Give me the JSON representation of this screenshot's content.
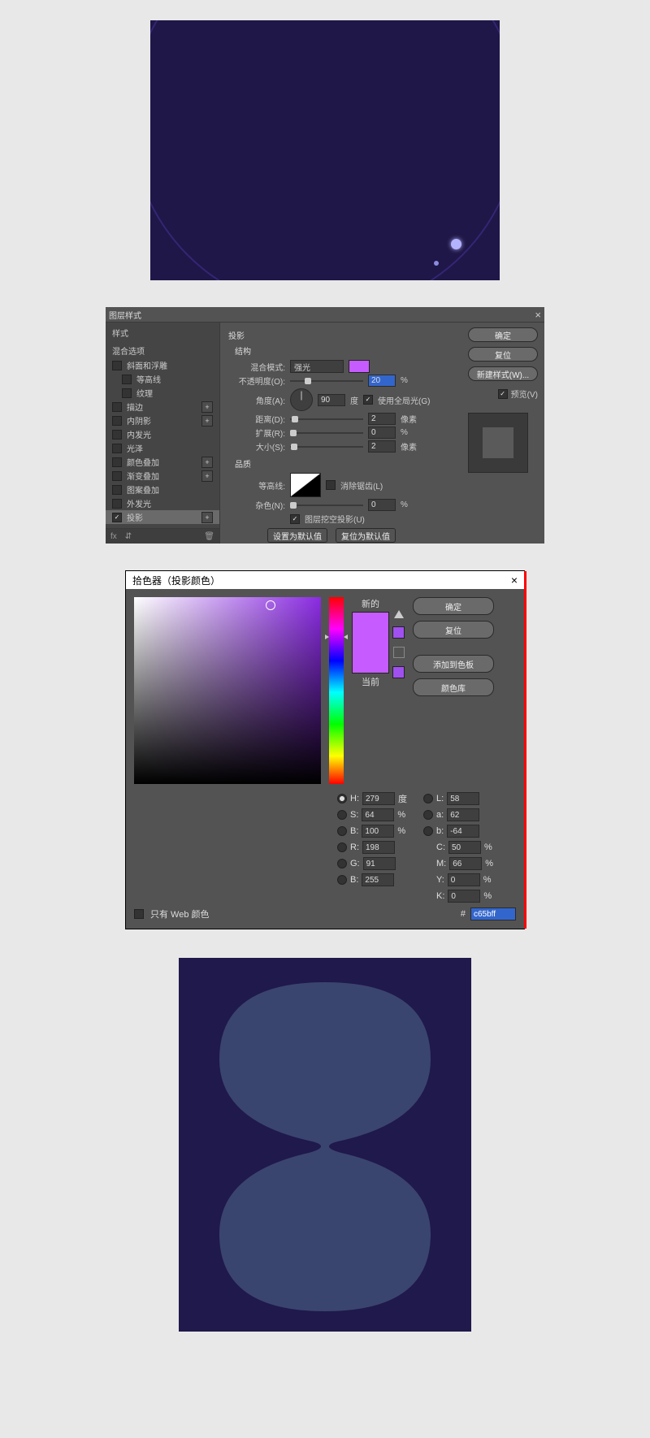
{
  "layer_style_dialog": {
    "title": "图层样式",
    "left": {
      "styles_header": "样式",
      "blend_options": "混合选项",
      "items": [
        {
          "label": "斜面和浮雕",
          "checked": false,
          "plus": false
        },
        {
          "label": "等高线",
          "checked": false,
          "plus": false,
          "indent": true
        },
        {
          "label": "纹理",
          "checked": false,
          "plus": false,
          "indent": true
        },
        {
          "label": "描边",
          "checked": false,
          "plus": true
        },
        {
          "label": "内阴影",
          "checked": false,
          "plus": true
        },
        {
          "label": "内发光",
          "checked": false,
          "plus": false
        },
        {
          "label": "光泽",
          "checked": false,
          "plus": false
        },
        {
          "label": "颜色叠加",
          "checked": false,
          "plus": true
        },
        {
          "label": "渐变叠加",
          "checked": false,
          "plus": true
        },
        {
          "label": "图案叠加",
          "checked": false,
          "plus": false
        },
        {
          "label": "外发光",
          "checked": false,
          "plus": false
        },
        {
          "label": "投影",
          "checked": true,
          "plus": true,
          "selected": true
        }
      ],
      "footer_fx": "fx"
    },
    "mid": {
      "section": "投影",
      "structure": "结构",
      "blend_mode_label": "混合模式:",
      "blend_mode_value": "强光",
      "opacity_label": "不透明度(O):",
      "opacity_value": "20",
      "opacity_unit": "%",
      "angle_label": "角度(A):",
      "angle_value": "90",
      "angle_unit": "度",
      "global_light": "使用全局光(G)",
      "distance_label": "距离(D):",
      "distance_value": "2",
      "distance_unit": "像素",
      "spread_label": "扩展(R):",
      "spread_value": "0",
      "spread_unit": "%",
      "size_label": "大小(S):",
      "size_value": "2",
      "size_unit": "像素",
      "quality": "品质",
      "contour_label": "等高线:",
      "antialias": "消除锯齿(L)",
      "noise_label": "杂色(N):",
      "noise_value": "0",
      "noise_unit": "%",
      "knockout": "图层挖空投影(U)",
      "make_default": "设置为默认值",
      "reset_default": "复位为默认值"
    },
    "right": {
      "ok": "确定",
      "cancel": "复位",
      "new_style": "新建样式(W)...",
      "preview": "预览(V)"
    },
    "swatch_color": "#c65bff"
  },
  "color_picker": {
    "title": "拾色器（投影颜色）",
    "buttons": {
      "ok": "确定",
      "cancel": "复位",
      "add": "添加到色板",
      "lib": "颜色库"
    },
    "new_label": "新的",
    "current_label": "当前",
    "hsb": {
      "h": "279",
      "h_unit": "度",
      "s": "64",
      "s_unit": "%",
      "b": "100",
      "b_unit": "%"
    },
    "rgb": {
      "r": "198",
      "g": "91",
      "b": "255"
    },
    "lab": {
      "l": "58",
      "a": "62",
      "b2": "-64"
    },
    "cmyk": {
      "c": "50",
      "m": "66",
      "y": "0",
      "k": "0"
    },
    "percent": "%",
    "hex_prefix": "#",
    "hex": "c65bff",
    "web_only": "只有 Web 颜色",
    "field_labels": {
      "H": "H:",
      "S": "S:",
      "B": "B:",
      "R": "R:",
      "G": "G:",
      "Bb": "B:",
      "L": "L:",
      "a": "a:",
      "b": "b:",
      "C": "C:",
      "M": "M:",
      "Y": "Y:",
      "K": "K:"
    }
  }
}
